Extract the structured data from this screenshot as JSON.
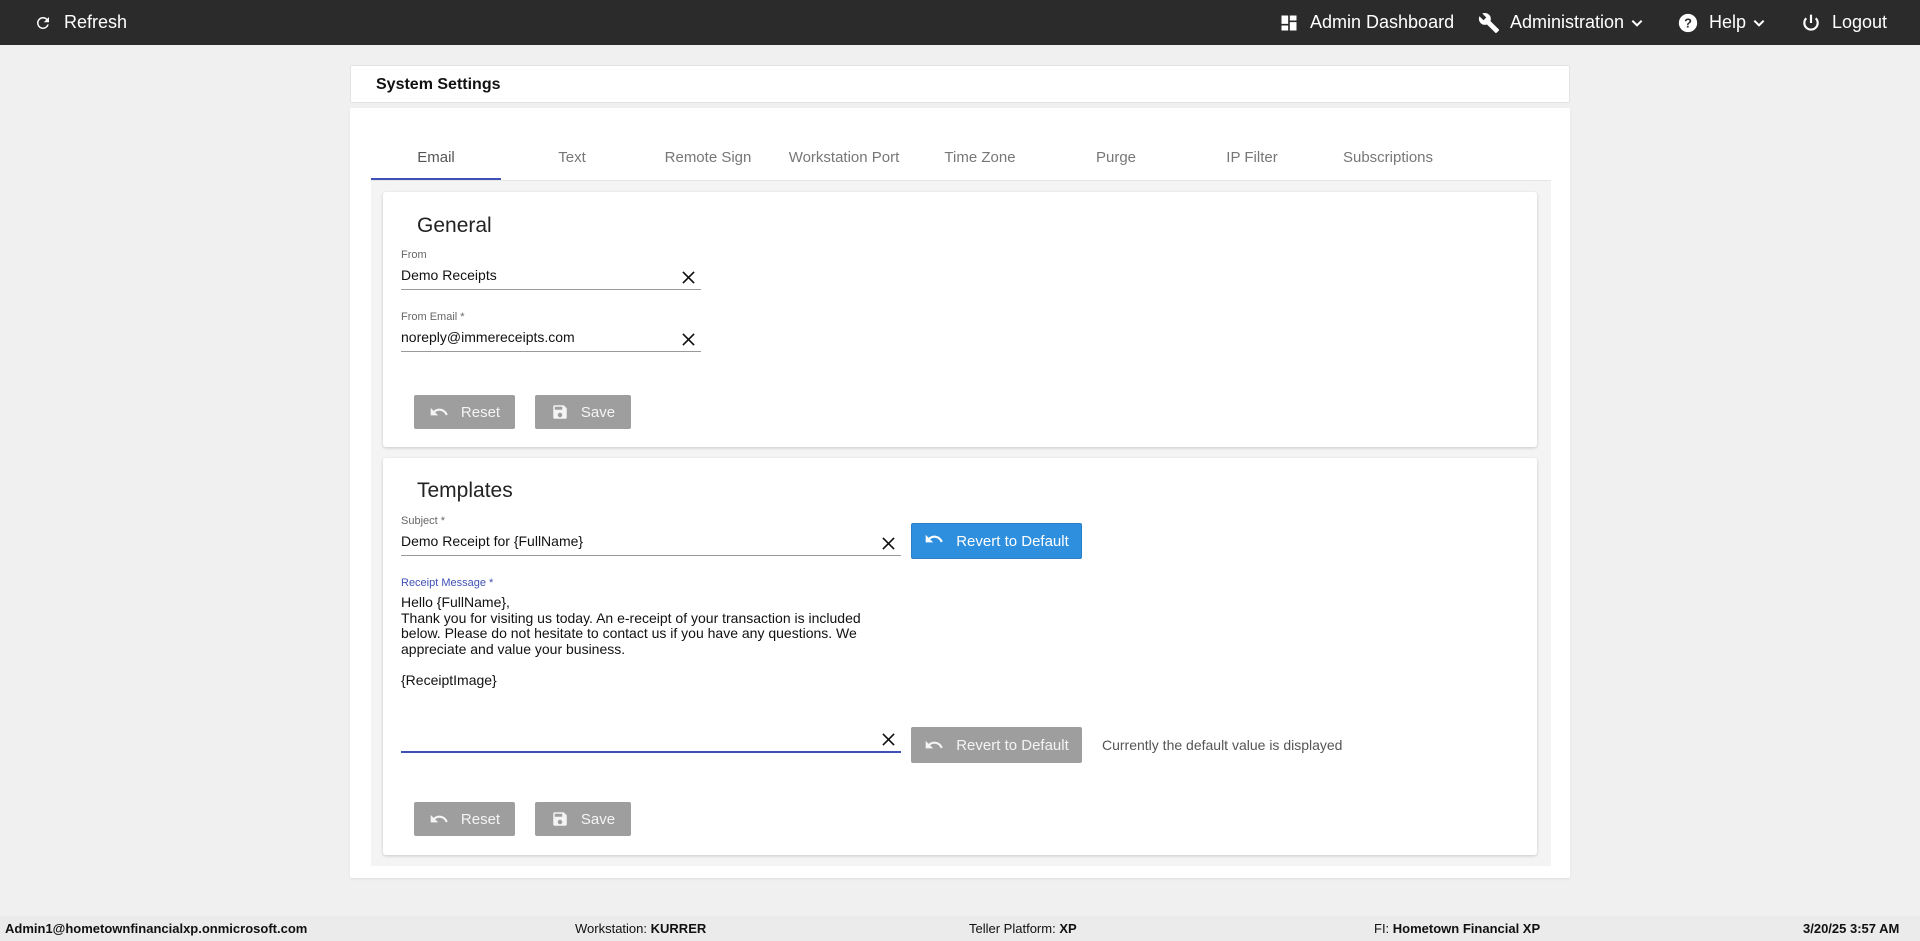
{
  "topbar": {
    "refresh": "Refresh",
    "admin_dashboard": "Admin Dashboard",
    "administration": "Administration",
    "help": "Help",
    "logout": "Logout"
  },
  "header": {
    "title": "System Settings"
  },
  "tabs": [
    {
      "label": "Email",
      "active": true
    },
    {
      "label": "Text"
    },
    {
      "label": "Remote Sign"
    },
    {
      "label": "Workstation Port"
    },
    {
      "label": "Time Zone"
    },
    {
      "label": "Purge"
    },
    {
      "label": "IP Filter"
    },
    {
      "label": "Subscriptions"
    }
  ],
  "general": {
    "title": "General",
    "from_label": "From",
    "from_value": "Demo Receipts",
    "from_email_label": "From Email *",
    "from_email_value": "noreply@immereceipts.com",
    "reset_label": "Reset",
    "save_label": "Save"
  },
  "templates": {
    "title": "Templates",
    "subject_label": "Subject *",
    "subject_value": "Demo Receipt for {FullName}",
    "revert_label": "Revert to Default",
    "message_label": "Receipt Message *",
    "message_value": "Hello {FullName},\nThank you for visiting us today. An e-receipt of your transaction is included below. Please do not hesitate to contact us if you have any questions. We appreciate and value your business.\n\n{ReceiptImage}",
    "revert_label_2": "Revert to Default",
    "default_hint": "Currently the default value is displayed",
    "reset_label": "Reset",
    "save_label": "Save"
  },
  "footer": {
    "user": "Admin1@hometownfinancialxp.onmicrosoft.com",
    "workstation_label": "Workstation:",
    "workstation_value": "KURRER",
    "platform_label": "Teller Platform:",
    "platform_value": "XP",
    "fi_label": "FI:",
    "fi_value": "Hometown Financial XP",
    "datetime": "3/20/25 3:57 AM"
  },
  "colors": {
    "topbar": "#2b2b2b",
    "accent": "#3f51b5",
    "primary_button": "#2f8fdf",
    "disabled_button": "#9e9e9e"
  }
}
